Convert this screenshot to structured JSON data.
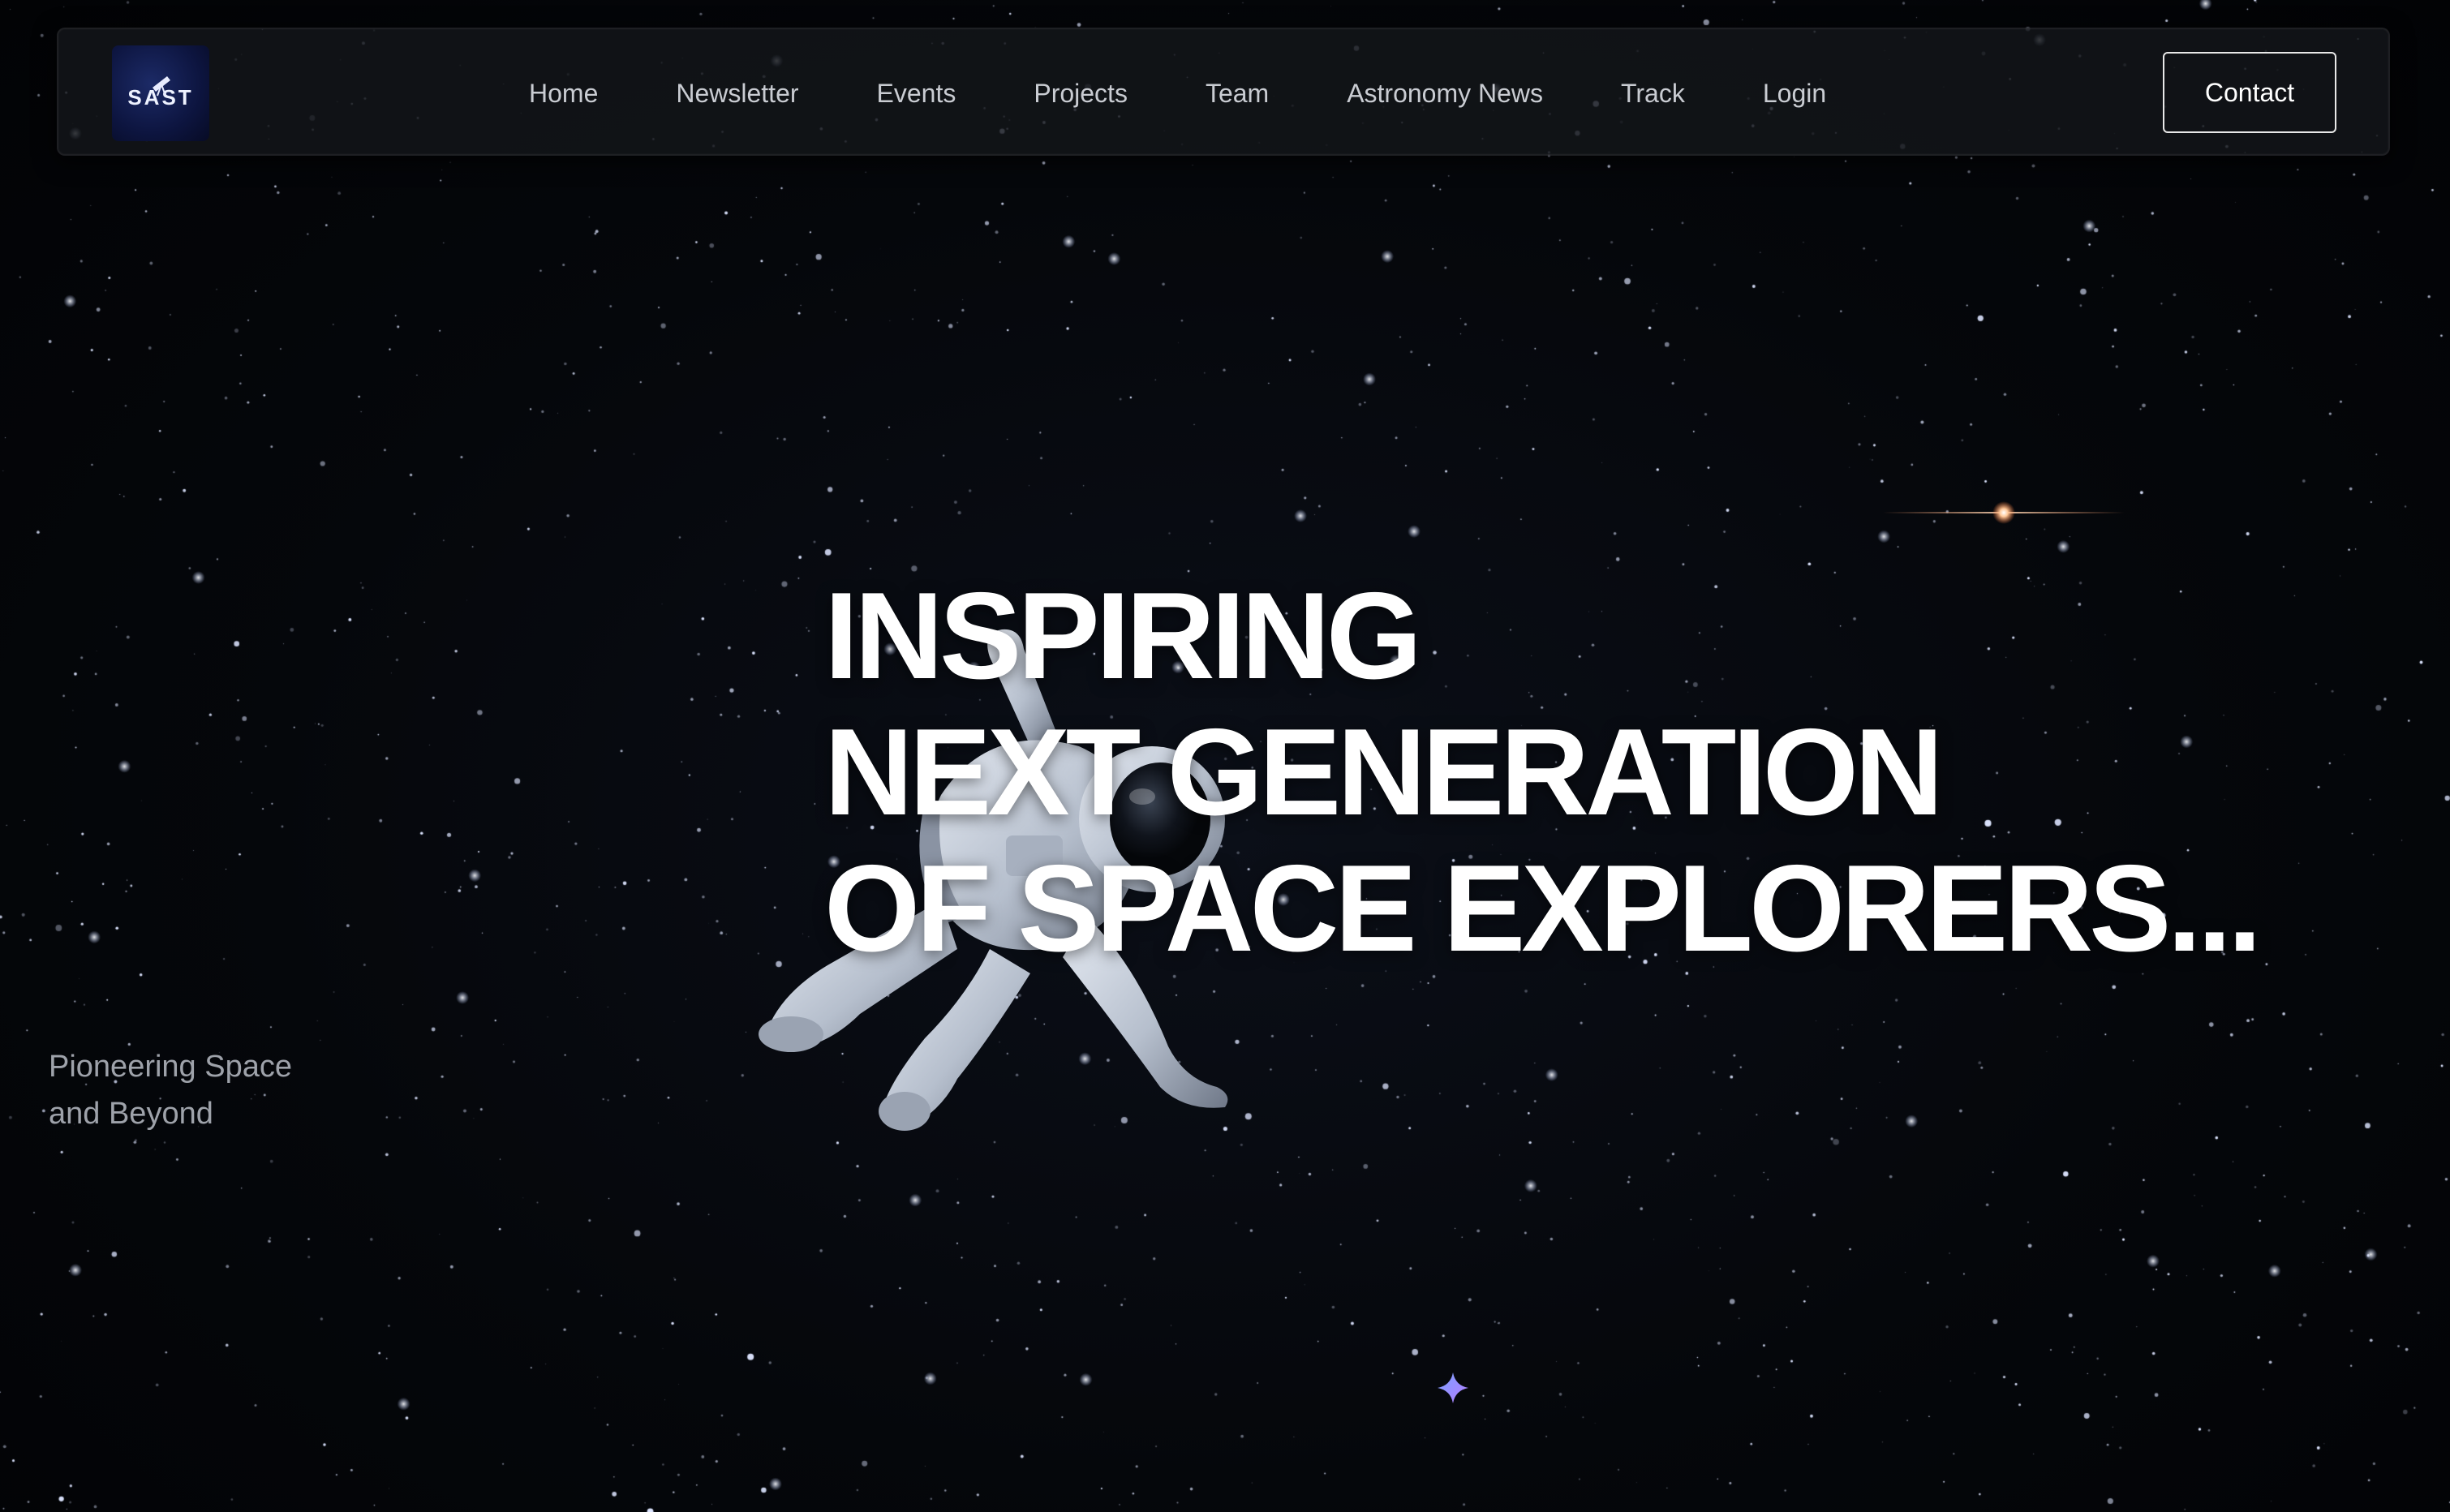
{
  "logo": {
    "text": "SAST",
    "icon": "telescope-icon"
  },
  "nav": {
    "items": [
      {
        "label": "Home"
      },
      {
        "label": "Newsletter"
      },
      {
        "label": "Events"
      },
      {
        "label": "Projects"
      },
      {
        "label": "Team"
      },
      {
        "label": "Astronomy News"
      },
      {
        "label": "Track"
      },
      {
        "label": "Login"
      }
    ],
    "contact_label": "Contact"
  },
  "hero": {
    "line1": "INSPIRING",
    "line2": "NEXT GENERATION",
    "line3": "OF SPACE EXPLORERS...",
    "tagline_line1": "Pioneering Space",
    "tagline_line2": "and Beyond"
  },
  "icons": {
    "sparkle": "sparkle-icon",
    "astronaut": "astronaut-illustration"
  },
  "colors": {
    "background": "#030407",
    "navbar_bg": "#14161a",
    "text_primary": "#ffffff",
    "text_nav": "#c9ccd2",
    "text_muted": "#9ea2aa",
    "sparkle_start": "#7aa2ff",
    "sparkle_end": "#b57cff"
  }
}
